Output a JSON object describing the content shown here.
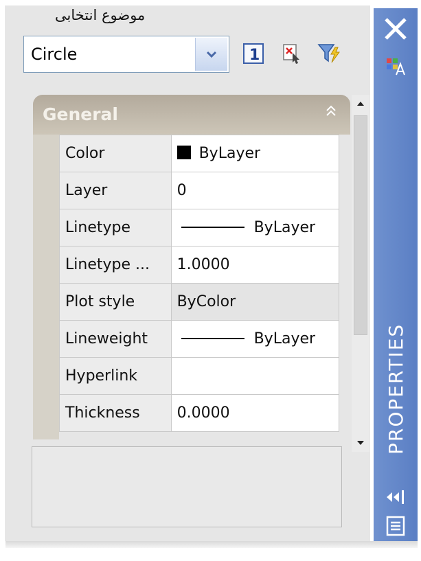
{
  "annotation_label": "موضوع انتخابی",
  "selector": {
    "value": "Circle"
  },
  "toolbar": {
    "buttons": [
      {
        "name": "toggle-pickadd-button",
        "glyph": "1"
      },
      {
        "name": "select-objects-button"
      },
      {
        "name": "quick-select-button"
      }
    ]
  },
  "section": {
    "title": "General"
  },
  "properties": [
    {
      "name": "Color",
      "value": "ByLayer"
    },
    {
      "name": "Layer",
      "value": "0"
    },
    {
      "name": "Linetype",
      "value": "ByLayer"
    },
    {
      "name": "Linetype ...",
      "value": "1.0000"
    },
    {
      "name": "Plot style",
      "value": "ByColor"
    },
    {
      "name": "Lineweight",
      "value": "ByLayer"
    },
    {
      "name": "Hyperlink",
      "value": ""
    },
    {
      "name": "Thickness",
      "value": "0.0000"
    }
  ],
  "titlebar": {
    "title": "PROPERTIES"
  },
  "colors": {
    "titlebar": "#6a8dcc",
    "section_header": "#bdb5a8",
    "panel": "#e6e6e6"
  }
}
